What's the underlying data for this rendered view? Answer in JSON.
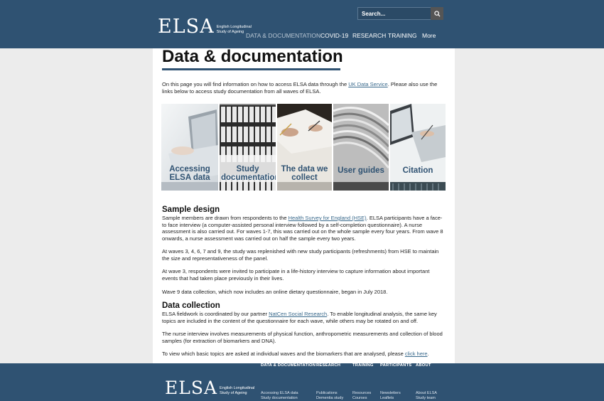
{
  "header": {
    "logo_mark": "ELSA",
    "logo_line1": "English Longitudinal",
    "logo_line2": "Study of Ageing",
    "search_placeholder": "Search...",
    "nav": [
      "DATA & DOCUMENTATION",
      "COVID-19",
      "RESEARCH",
      "TRAINING",
      "More"
    ]
  },
  "main": {
    "title": "Data & documentation",
    "intro_before": "On this page you will find information on how to access ELSA data through the ",
    "intro_link": "UK Data Service",
    "intro_after": ". Please also use the links below to access study documentation from all waves of ELSA.",
    "tiles": [
      {
        "line1": "Accessing",
        "line2": "ELSA data"
      },
      {
        "line1": "Study",
        "line2": "documentation"
      },
      {
        "line1": "The data we",
        "line2": "collect"
      },
      {
        "line1": "User guides",
        "line2": ""
      },
      {
        "line1": "Citation",
        "line2": ""
      }
    ],
    "sample_design": {
      "heading": "Sample design",
      "p1_before": "Sample members are drawn from respondents to the ",
      "p1_link": "Health Survey for England (HSE)",
      "p1_after": ". ELSA participants have a face-to face interview (a computer-assisted personal interview followed by a self-completion questionnaire). A nurse assessment is also carried out. For waves 1-7, this was carried out on the whole sample every four years. From wave 8 onwards, a nurse assessment was carried out on half the sample every two years.",
      "p2": "At waves 3, 4, 6, 7 and 9, the study was replenished with new study participants (refreshments) from HSE to maintain the size and representativeness of the panel.",
      "p3": "At wave 3, respondents were invited to participate in a life-history interview to capture information about important events that had taken place previously in their lives.",
      "p4": "Wave 9 data collection, which now includes an online dietary questionnaire, began in July 2018."
    },
    "data_collection": {
      "heading": "Data collection",
      "p1_before": "ELSA fieldwork is coordinated by our partner ",
      "p1_link": "NatCen Social Research",
      "p1_after": ". To enable longitudinal analysis, the same key topics are included in the content of the questionnaire for each wave, while others may be rotated on and off.",
      "p2": "The nurse interview involves measurements of physical function, anthropometric measurements and collection of blood samples (for extraction of biomarkers and DNA).",
      "p3_before": "To view which basic topics are asked at individual waves and the biomarkers that are analysed, please ",
      "p3_link": "click here",
      "p3_after": "."
    }
  },
  "footer": {
    "columns": [
      {
        "heading": "DATA & DOCUMENTATION",
        "items": [
          "Accessing ELSA data",
          "Study documentation"
        ]
      },
      {
        "heading": "RESEARCH",
        "items": [
          "Publications",
          "Dementia study"
        ]
      },
      {
        "heading": "TRAINING",
        "items": [
          "Resources",
          "Courses"
        ]
      },
      {
        "heading": "PARTICIPANTS",
        "items": [
          "Newsletters",
          "Leaflets"
        ]
      },
      {
        "heading": "ABOUT",
        "items": [
          "About ELSA",
          "Study team"
        ]
      }
    ]
  },
  "colors": {
    "brand": "#2f5272",
    "link": "#3a6a8c",
    "background": "#ececec"
  },
  "icons": {
    "search": "search-icon"
  }
}
